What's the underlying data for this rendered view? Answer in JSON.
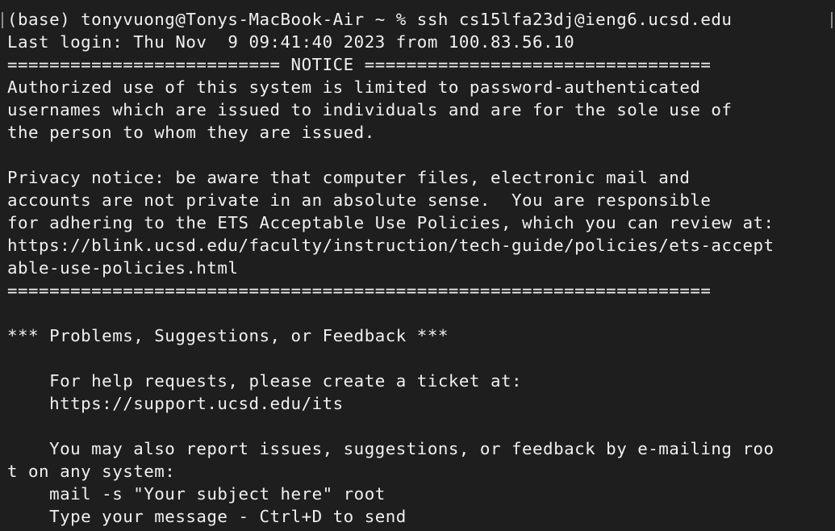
{
  "terminal": {
    "background": "#1e1e1e",
    "foreground": "#f0f0f0",
    "lines": [
      "(base) tonyvuong@Tonys-MacBook-Air ~ % ssh cs15lfa23dj@ieng6.ucsd.edu",
      "Last login: Thu Nov  9 09:41:40 2023 from 100.83.56.10",
      "========================== NOTICE =================================",
      "Authorized use of this system is limited to password-authenticated",
      "usernames which are issued to individuals and are for the sole use of",
      "the person to whom they are issued.",
      "",
      "Privacy notice: be aware that computer files, electronic mail and",
      "accounts are not private in an absolute sense.  You are responsible",
      "for adhering to the ETS Acceptable Use Policies, which you can review at:",
      "https://blink.ucsd.edu/faculty/instruction/tech-guide/policies/ets-accept",
      "able-use-policies.html",
      "===================================================================",
      "",
      "*** Problems, Suggestions, or Feedback ***",
      "",
      "    For help requests, please create a ticket at:",
      "    https://support.ucsd.edu/its",
      "",
      "    You may also report issues, suggestions, or feedback by e-mailing roo",
      "t on any system:",
      "    mail -s \"Your subject here\" root",
      "    Type your message - Ctrl+D to send"
    ]
  }
}
